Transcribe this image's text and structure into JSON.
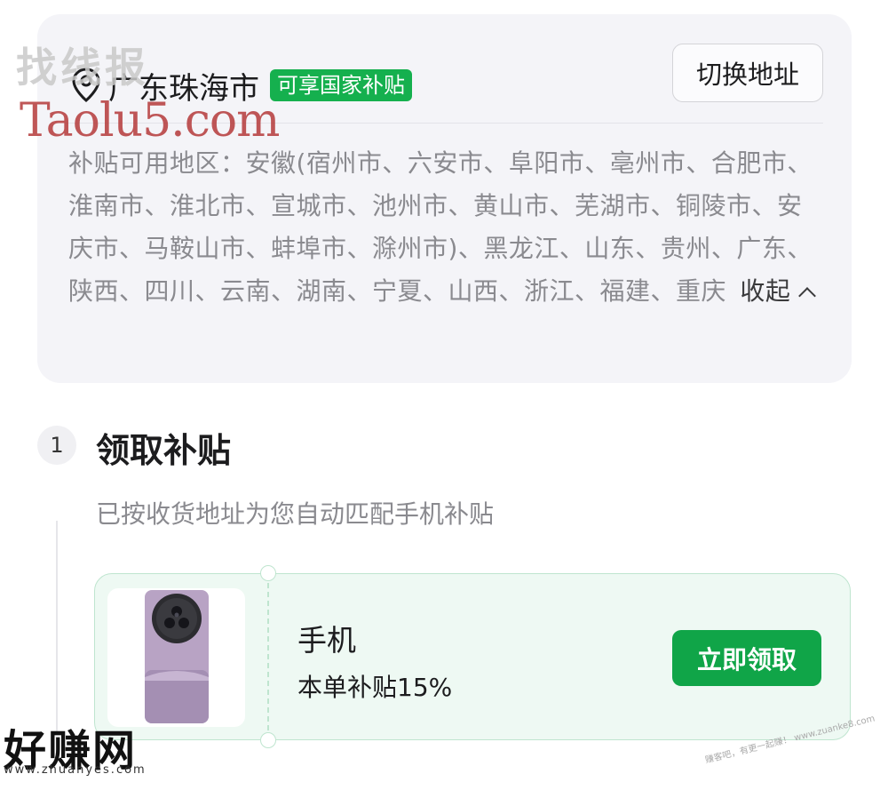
{
  "address": {
    "city": "广东珠海市",
    "tag": "可享国家补贴",
    "switch_label": "切换地址",
    "regions_text": "补贴可用地区：安徽(宿州市、六安市、阜阳市、亳州市、合肥市、淮南市、淮北市、宣城市、池州市、黄山市、芜湖市、铜陵市、安庆市、马鞍山市、蚌埠市、滁州市)、黑龙江、山东、贵州、广东、陕西、四川、云南、湖南、宁夏、山西、浙江、福建、重庆",
    "collapse_label": "收起",
    "pin_icon": "location-pin-icon"
  },
  "step": {
    "number": "1",
    "title": "领取补贴",
    "description": "已按收货地址为您自动匹配手机补贴"
  },
  "coupon": {
    "name": "手机",
    "rate": "本单补贴15%",
    "claim_label": "立即领取",
    "accent": "#10a548"
  },
  "watermarks": {
    "top_cn": "找线报",
    "top_en": "Taolu5.com",
    "bottom_cn": "好赚网",
    "bottom_url": "www.zhuanyes.com",
    "corner": "赚客吧，有更一起赚！ www.zuanke8.com"
  }
}
